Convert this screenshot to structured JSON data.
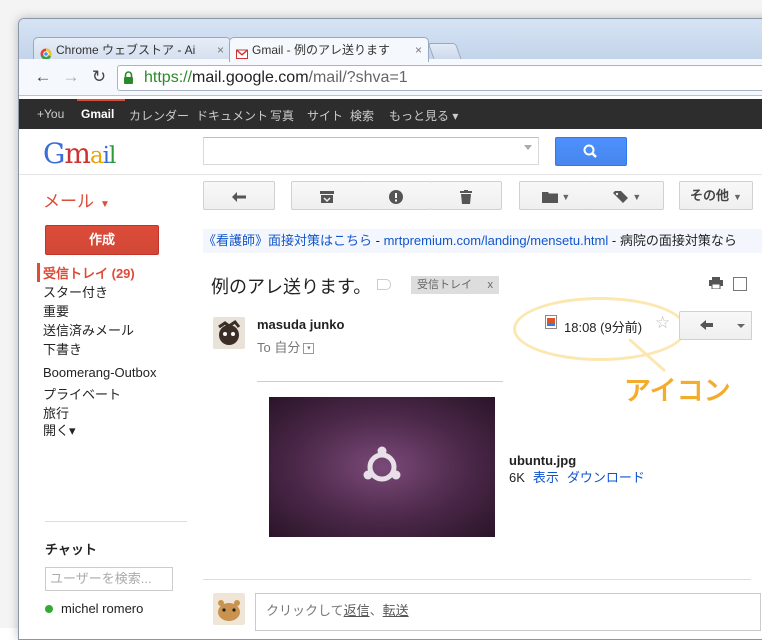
{
  "browser": {
    "tabs": [
      {
        "title": "Chrome ウェブストア - Ai",
        "close": "×"
      },
      {
        "title": "Gmail - 例のアレ送ります",
        "close": "×"
      }
    ],
    "url_scheme": "https://",
    "url_host": "mail.google.com",
    "url_path": "/mail/?shva=1"
  },
  "gbar": {
    "items": [
      "+You",
      "Gmail",
      "カレンダー",
      "ドキュメント",
      "写真",
      "サイト",
      "検索",
      "もっと見る ▾"
    ]
  },
  "logo": {
    "g": "G",
    "m": "m",
    "a": "a",
    "i": "i",
    "l": "l"
  },
  "header": {
    "mail_label": "メール",
    "more_button": "その他"
  },
  "sidebar": {
    "compose": "作成",
    "items": [
      "受信トレイ (29)",
      "スター付き",
      "重要",
      "送信済みメール",
      "下書き",
      "Boomerang-Outbox",
      "プライベート",
      "旅行",
      "開く▾"
    ]
  },
  "ad": {
    "link": "《看護師》面接対策はこちら",
    "dash": " - ",
    "url": "mrtpremium.com/landing/mensetu.html",
    "text": " - 病院の面接対策なら"
  },
  "message": {
    "subject": "例のアレ送ります。",
    "label": "受信トレイ",
    "label_close": "x",
    "sender": "masuda junko",
    "to": "To 自分",
    "to_toggle": "▾",
    "time": "18:08 (9分前)",
    "star": "☆"
  },
  "annotation": {
    "callout": "アイコン"
  },
  "attachment": {
    "filename": "ubuntu.jpg",
    "size": "6K",
    "view": "表示",
    "download": "ダウンロード"
  },
  "chat": {
    "title": "チャット",
    "search_placeholder": "ユーザーを検索...",
    "user": "michel romero"
  },
  "reply": {
    "prefix": "クリックして",
    "reply_link": "返信",
    "sep": "、",
    "forward_link": "転送"
  },
  "colors": {
    "accent": "#dd4b39",
    "link": "#1155cc",
    "callout": "#f4ac2c",
    "search_btn": "#4d90fe"
  }
}
